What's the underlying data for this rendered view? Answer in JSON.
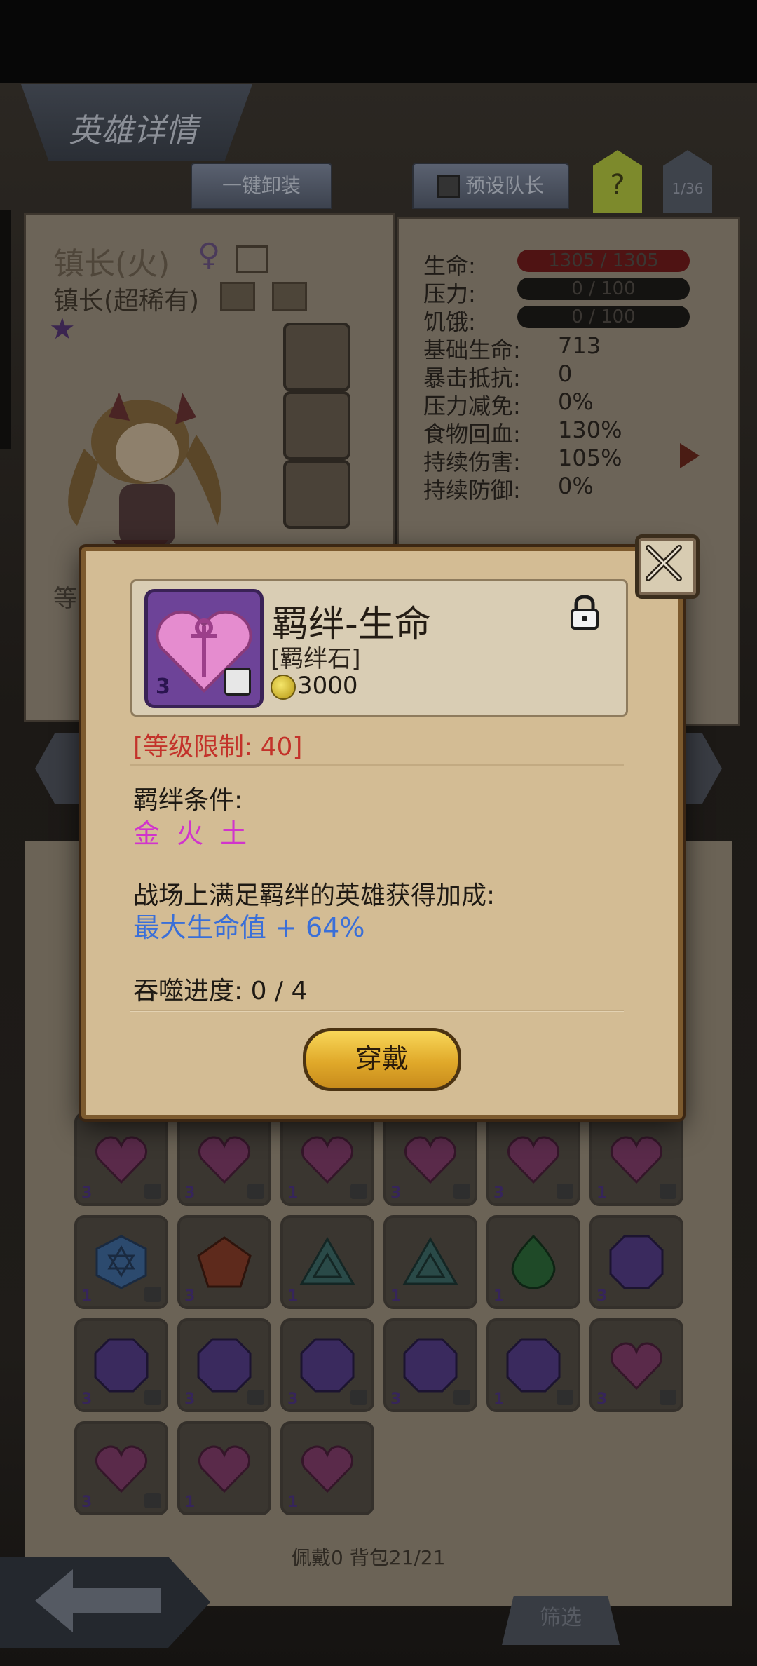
{
  "header": {
    "title": "英雄详情"
  },
  "tabs": {
    "unequip_all": "一键卸装",
    "preset_captain": "预设队长",
    "help": "?",
    "page": "1/36"
  },
  "hero": {
    "name": "镇长(火)",
    "gender_icon": "female-icon",
    "class": "镇长(超稀有)",
    "level_prefix": "等"
  },
  "stats": {
    "rows_bar": [
      {
        "label": "生命:",
        "value": "1305 / 1305",
        "color": "#5a1414"
      },
      {
        "label": "压力:",
        "value": "0 / 100",
        "color": "#141311"
      },
      {
        "label": "饥饿:",
        "value": "0 / 100",
        "color": "#141311"
      }
    ],
    "rows_text": [
      {
        "label": "基础生命:",
        "value": "713"
      },
      {
        "label": "暴击抵抗:",
        "value": "0"
      },
      {
        "label": "压力减免:",
        "value": "0%"
      },
      {
        "label": "食物回血:",
        "value": "130%"
      },
      {
        "label": "持续伤害:",
        "value": "105%"
      },
      {
        "label": "持续防御:",
        "value": "0%"
      }
    ]
  },
  "dialog": {
    "item_name": "羁绊-生命",
    "item_type": "[羁绊石]",
    "price": "3000",
    "item_count": "3",
    "level_limit": "[等级限制: 40]",
    "condition_title": "羁绊条件:",
    "condition_value": "金 火 土",
    "bonus_title": "战场上满足羁绊的英雄获得加成:",
    "bonus_value": "最大生命值 + 64%",
    "devour_progress": "吞噬进度: 0 / 4",
    "equip_label": "穿戴",
    "accent_magenta": "#d134cc",
    "accent_blue": "#3a6fd8",
    "accent_red": "#c3322a"
  },
  "inventory": {
    "footer": "佩戴0 背包21/21",
    "filter_label": "筛选",
    "items": [
      {
        "gem": "heart",
        "count": "3",
        "locked": true
      },
      {
        "gem": "heart",
        "count": "3",
        "locked": true
      },
      {
        "gem": "heart",
        "count": "1",
        "locked": true
      },
      {
        "gem": "heart",
        "count": "3",
        "locked": true
      },
      {
        "gem": "heart",
        "count": "3",
        "locked": true
      },
      {
        "gem": "heart",
        "count": "1",
        "locked": true
      },
      {
        "gem": "hexagon-blue",
        "count": "1",
        "locked": true
      },
      {
        "gem": "pentagon-red",
        "count": "3",
        "locked": false
      },
      {
        "gem": "triangle-teal",
        "count": "1",
        "locked": false
      },
      {
        "gem": "triangle-teal",
        "count": "1",
        "locked": false
      },
      {
        "gem": "drop-green",
        "count": "1",
        "locked": false
      },
      {
        "gem": "octagon-purple",
        "count": "3",
        "locked": false
      },
      {
        "gem": "octagon-purple",
        "count": "3",
        "locked": true
      },
      {
        "gem": "octagon-purple",
        "count": "3",
        "locked": true
      },
      {
        "gem": "octagon-purple",
        "count": "3",
        "locked": true
      },
      {
        "gem": "octagon-purple",
        "count": "3",
        "locked": true
      },
      {
        "gem": "octagon-purple",
        "count": "1",
        "locked": true
      },
      {
        "gem": "heart",
        "count": "3",
        "locked": true
      },
      {
        "gem": "heart",
        "count": "3",
        "locked": true
      },
      {
        "gem": "heart",
        "count": "1",
        "locked": false
      },
      {
        "gem": "heart",
        "count": "1",
        "locked": false
      }
    ]
  }
}
